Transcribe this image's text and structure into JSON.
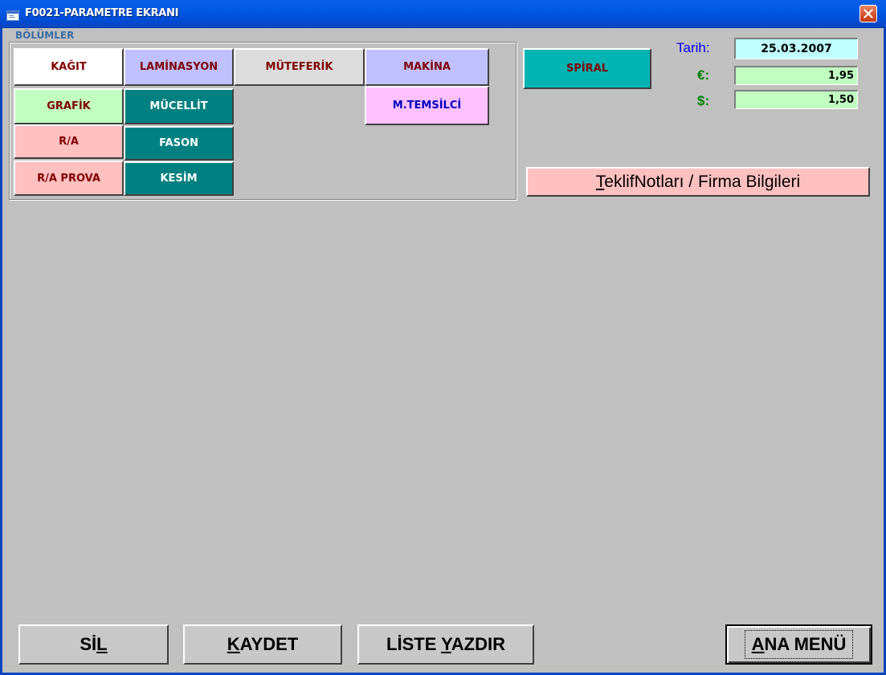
{
  "window": {
    "title": "F0021-PARAMETRE EKRANI"
  },
  "group": {
    "label": "BÖLÜMLER"
  },
  "sections": {
    "kagit": "KAĞIT",
    "laminasyon": "LAMİNASYON",
    "muteferik": "MÜTEFERİK",
    "makina": "MAKİNA",
    "spiral": "SPİRAL",
    "grafik": "GRAFİK",
    "mucellit": "MÜCELLİT",
    "mtemsilci": "M.TEMSİLCİ",
    "ra": "R/A",
    "fason": "FASON",
    "ra_prova": "R/A PROVA",
    "kesim": "KESİM"
  },
  "info": {
    "date_label": "Tarih:",
    "date_value": "25.03.2007",
    "euro_label": "€:",
    "euro_value": "1,95",
    "dollar_label": "$:",
    "dollar_value": "1,50"
  },
  "notes_button": {
    "mnemonic": "T",
    "rest": "eklifNotları / Firma Bilgileri"
  },
  "bottom": {
    "sil_a": "Sİ",
    "sil_m": "L",
    "kaydet_m": "K",
    "kaydet_b": "AYDET",
    "liste_a": "LİSTE ",
    "liste_m": "Y",
    "liste_b": "AZDIR",
    "ana_m": "A",
    "ana_b": "NA MENÜ"
  },
  "colors": {
    "pink": "#ffc0c0",
    "lavender": "#c0c0ff",
    "teal": "#008080",
    "light_green": "#c0ffc0",
    "light_pink_purple": "#ffc0ff",
    "light_cyan": "#c0ffff",
    "dark_red_text": "#800000"
  }
}
